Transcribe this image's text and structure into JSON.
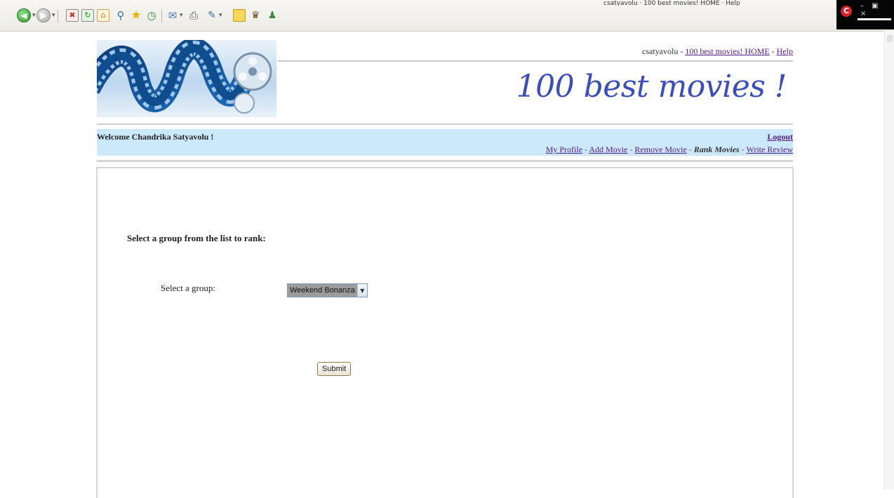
{
  "browser": {
    "title_strip": "csatyavolu · 100 best movies! HOME · Help",
    "icons": [
      "back-arrow-icon",
      "forward-arrow-icon",
      "stop-icon",
      "refresh-icon",
      "home-icon",
      "search-icon",
      "favorites-star-icon",
      "history-icon",
      "mail-icon",
      "print-icon",
      "edit-icon",
      "folder-icon",
      "messenger-icon",
      "msn-icon"
    ]
  },
  "header": {
    "username": "csatyavolu",
    "home_link": "100 best movies! HOME",
    "help_link": "Help",
    "separator": " - ",
    "site_title": "100 best movies !"
  },
  "welcome": {
    "text": "Welcome Chandrika Satyavolu !",
    "logout": "Logout"
  },
  "nav": {
    "my_profile": "My Profile",
    "add_movie": "Add Movie",
    "remove_movie": "Remove Movie",
    "rank_movies": "Rank Movies",
    "write_review": "Write Review",
    "sep": " - "
  },
  "form": {
    "instruction": "Select a group from the list to rank:",
    "group_label": "Select a group:",
    "group_selected": "Weekend Bonanza",
    "submit_label": "Submit"
  }
}
